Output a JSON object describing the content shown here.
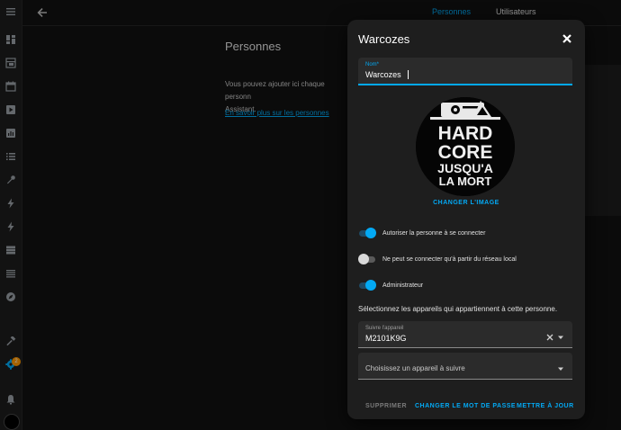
{
  "header": {
    "tabs": [
      {
        "label": "Personnes",
        "active": true
      },
      {
        "label": "Utilisateurs",
        "active": false
      }
    ]
  },
  "sidebar": {
    "icons": [
      "menu-icon",
      "dashboard-icon",
      "energy-icon",
      "calendar-icon",
      "media-icon",
      "history-icon",
      "logbook-icon",
      "tools-icon",
      "lightning-icon",
      "lightning-icon",
      "server-icon",
      "list-icon",
      "compass-icon",
      "hammer-icon",
      "settings-icon",
      "bell-icon",
      "user-avatar"
    ],
    "settings_badge": "2"
  },
  "content": {
    "title": "Personnes",
    "description": "Vous pouvez ajouter ici chaque personn\nAssistant.",
    "link": "En savoir plus sur les personnes"
  },
  "dialog": {
    "title": "Warcozes",
    "name_field": {
      "label": "Nom*",
      "value": "Warcozes"
    },
    "avatar_text": [
      "HARD",
      "CORE",
      "JUSQU'A",
      "LA MORT"
    ],
    "change_image": "CHANGER L'IMAGE",
    "toggles": [
      {
        "label": "Autoriser la personne à se connecter",
        "checked": true
      },
      {
        "label": "Ne peut se connecter qu'à partir du réseau local",
        "checked": false
      },
      {
        "label": "Administrateur",
        "checked": true
      }
    ],
    "devices_text": "Sélectionnez les appareils qui appartiennent à cette personne.",
    "device_field": {
      "label": "Suivre l'appareil",
      "value": "M2101K9G"
    },
    "device_select": {
      "placeholder": "Choisissez un appareil à suivre"
    },
    "buttons": {
      "delete": "SUPPRIMER",
      "change_password": "CHANGER LE MOT DE PASSE",
      "update": "METTRE À JOUR"
    }
  },
  "colors": {
    "accent": "#03a9f4",
    "background": "#111111",
    "dialog": "#1e1e1e",
    "badge": "#ff9800"
  }
}
